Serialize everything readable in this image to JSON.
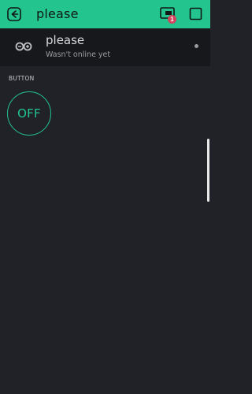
{
  "app_bar": {
    "title": "please",
    "back_icon": "exit-icon",
    "notification_icon": "notification-icon",
    "notification_count": "1",
    "edit_icon": "square-icon",
    "accent_color": "#23c48e",
    "badge_color": "#d3435c"
  },
  "device": {
    "icon": "infinity-icon",
    "name": "please",
    "status": "Wasn't online yet"
  },
  "widgets": [
    {
      "label": "BUTTON",
      "state_label": "OFF"
    }
  ]
}
